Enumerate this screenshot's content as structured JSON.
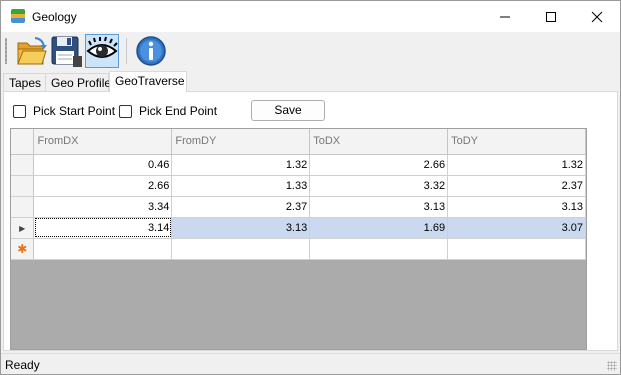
{
  "window": {
    "title": "Geology"
  },
  "tabs": [
    {
      "label": "Tapes"
    },
    {
      "label": "Geo Profile"
    },
    {
      "label": "GeoTraverse"
    }
  ],
  "controls": {
    "pick_start_label": "Pick Start Point",
    "pick_end_label": "Pick End Point",
    "save_label": "Save",
    "pick_start_checked": false,
    "pick_end_checked": false
  },
  "grid": {
    "columns": [
      "FromDX",
      "FromDY",
      "ToDX",
      "ToDY"
    ],
    "rows": [
      [
        "0.46",
        "1.32",
        "2.66",
        "1.32"
      ],
      [
        "2.66",
        "1.33",
        "3.32",
        "2.37"
      ],
      [
        "3.34",
        "2.37",
        "3.13",
        "3.13"
      ],
      [
        "3.14",
        "3.13",
        "1.69",
        "3.07"
      ]
    ],
    "selected_row": 3,
    "selection_color": "#cad9ef",
    "new_row_marker_color": "#e8731a"
  },
  "status": {
    "text": "Ready"
  },
  "icons": {
    "app": "geology-layers-icon",
    "open": "open-folder-icon",
    "save": "floppy-disk-icon",
    "view": "eye-icon",
    "info": "info-icon"
  }
}
